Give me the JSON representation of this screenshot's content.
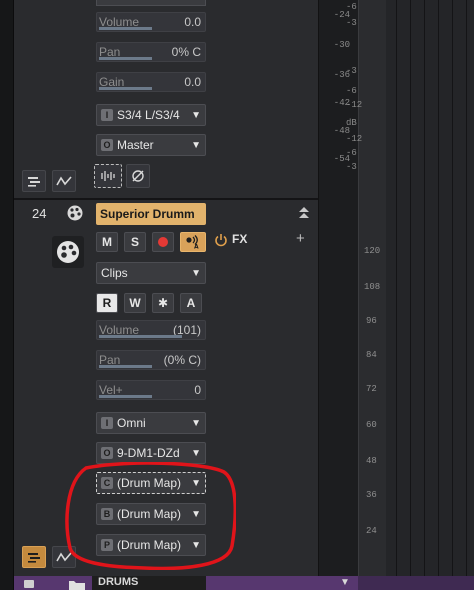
{
  "meter_labels": [
    "-24",
    "-30",
    "-36",
    "-42",
    "-48",
    "-54"
  ],
  "meter_side_labels": [
    "-6",
    "-3",
    "-3",
    "-6",
    "-12",
    "dB",
    "-12",
    "-6",
    "-3"
  ],
  "scale_labels": [
    "120",
    "108",
    "96",
    "84",
    "72",
    "60",
    "48",
    "36",
    "24"
  ],
  "track_top": {
    "volume": {
      "label": "Volume",
      "value": "0.0",
      "level": 0.5
    },
    "pan": {
      "label": "Pan",
      "value": "0% C",
      "level": 0.5
    },
    "gain": {
      "label": "Gain",
      "value": "0.0",
      "level": 0.5
    },
    "input": {
      "badge": "I",
      "value": "S3/4 L/S3/4"
    },
    "output": {
      "badge": "O",
      "value": "Master"
    }
  },
  "track_bottom": {
    "number": "24",
    "name": "Superior Drumm",
    "buttons": {
      "mute": "M",
      "solo": "S"
    },
    "fx_label": "FX",
    "fx_add": "+",
    "clips": "Clips",
    "mode_buttons": [
      "R",
      "W",
      "✱",
      "A"
    ],
    "volume": {
      "label": "Volume",
      "value": "(101)",
      "level": 0.78
    },
    "pan": {
      "label": "Pan",
      "value": "(0% C)",
      "level": 0.5
    },
    "vel": {
      "label": "Vel+",
      "value": "0",
      "level": 0.5
    },
    "input": {
      "badge": "I",
      "value": "Omni"
    },
    "output": {
      "badge": "O",
      "value": "9-DM1-DZd"
    },
    "drum_maps": [
      {
        "badge": "C",
        "value": "(Drum Map)"
      },
      {
        "badge": "B",
        "value": "(Drum Map)"
      },
      {
        "badge": "P",
        "value": "(Drum Map)"
      }
    ]
  },
  "folder": {
    "name": "DRUMS"
  },
  "colors": {
    "track_accent": "#e2b36c",
    "record": "#e53935",
    "annotation": "#e0141a",
    "folder": "#57376f"
  }
}
